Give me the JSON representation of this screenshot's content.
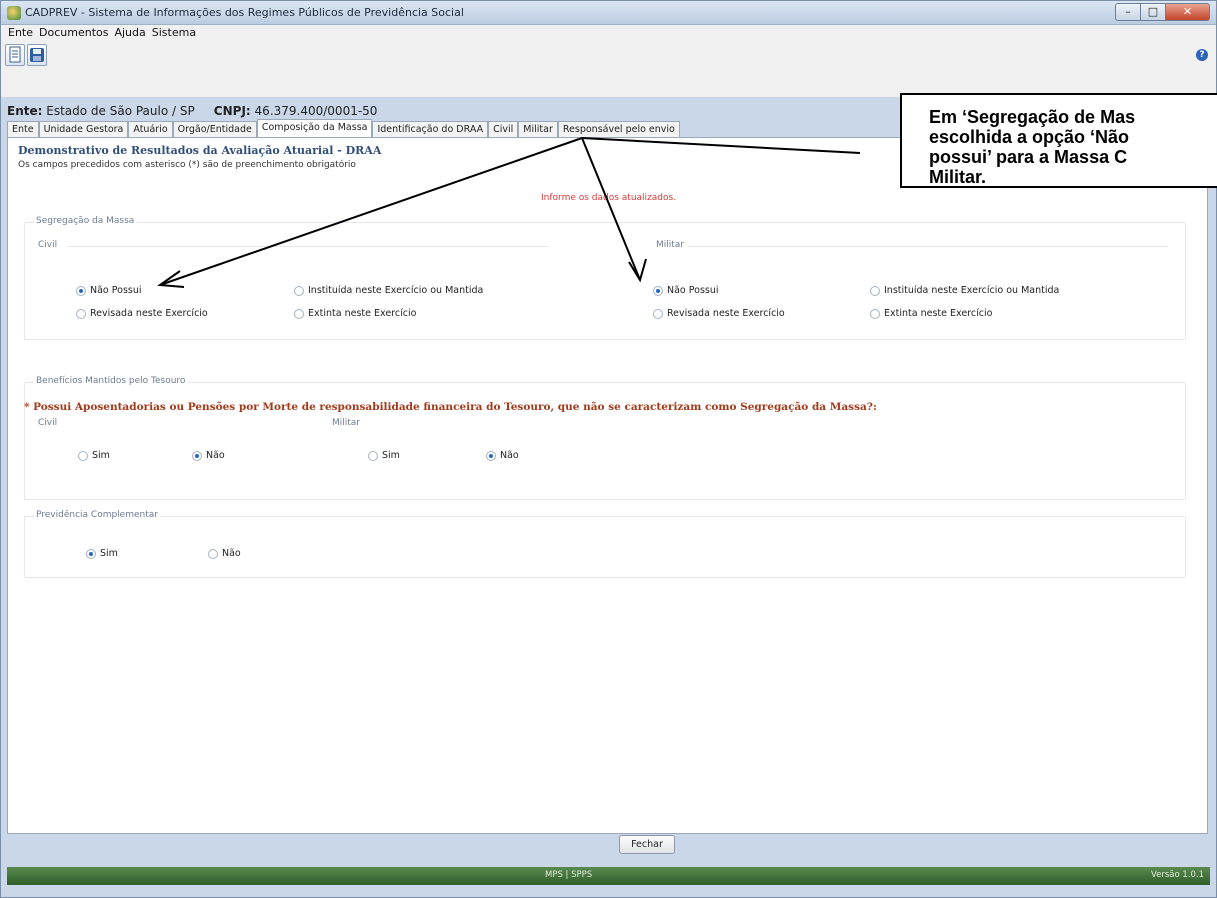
{
  "window": {
    "title": "CADPREV - Sistema de Informações dos Regimes Públicos de Previdência Social",
    "minimize_glyph": "–",
    "maximize_glyph": "□",
    "close_glyph": "✕"
  },
  "menu": [
    "Ente",
    "Documentos",
    "Ajuda",
    "Sistema"
  ],
  "toolbar": {
    "icons": [
      "document-icon",
      "save-icon"
    ],
    "help_glyph": "?"
  },
  "ente": {
    "label": "Ente:",
    "value": "Estado de São Paulo / SP",
    "cnpj_label": "CNPJ:",
    "cnpj_value": "46.379.400/0001-50"
  },
  "tabs": [
    "Ente",
    "Unidade Gestora",
    "Atuário",
    "Orgão/Entidade",
    "Composição da Massa",
    "Identificação do DRAA",
    "Civil",
    "Militar",
    "Responsável pelo envio"
  ],
  "active_tab": "Composição da Massa",
  "form": {
    "title": "Demonstrativo de Resultados da Avaliação Atuarial - DRAA",
    "subtitle": "Os campos precedidos com asterisco (*) são de preenchimento obrigatório",
    "info": "Informe os dados atualizados.",
    "segregacao": {
      "label": "Segregação da Massa",
      "civil": {
        "label": "Civil",
        "options": [
          "Não Possui",
          "Instituída neste Exercício ou Mantida",
          "Revisada neste Exercício",
          "Extinta neste Exercício"
        ],
        "selected": "Não Possui"
      },
      "militar": {
        "label": "Militar",
        "options": [
          "Não Possui",
          "Instituída neste Exercício ou Mantida",
          "Revisada neste Exercício",
          "Extinta neste Exercício"
        ],
        "selected": "Não Possui"
      }
    },
    "beneficios": {
      "label": "Benefícios Mantidos pelo Tesouro",
      "question": "* Possui Aposentadorias ou Pensões por Morte de responsabilidade financeira do Tesouro, que não se caracterizam como Segregação da Massa?:",
      "civil": {
        "label": "Civil",
        "options": [
          "Sim",
          "Não"
        ],
        "selected": "Não"
      },
      "militar": {
        "label": "Militar",
        "options": [
          "Sim",
          "Não"
        ],
        "selected": "Não"
      }
    },
    "previdencia": {
      "label": "Previdência Complementar",
      "options": [
        "Sim",
        "Não"
      ],
      "selected": "Sim"
    }
  },
  "buttons": {
    "close": "Fechar"
  },
  "status": {
    "center": "MPS | SPPS",
    "version": "Versão 1.0.1"
  },
  "callout": {
    "lines": [
      "Em ‘Segregação de Mas",
      "escolhida a opção ‘Não",
      "possui’ para a Massa C",
      "Militar."
    ]
  }
}
